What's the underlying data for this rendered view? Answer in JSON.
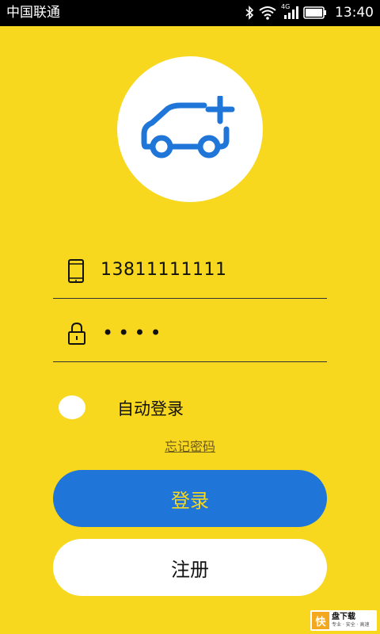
{
  "status_bar": {
    "carrier": "中国联通",
    "network": "4G",
    "time": "13:40"
  },
  "logo": {
    "icon": "car-plus-icon",
    "accent": "#1F76D8"
  },
  "login_form": {
    "phone_value": "13811111111",
    "password_value": "••••",
    "auto_login_label": "自动登录",
    "forgot_password_label": "忘记密码",
    "login_button_label": "登录",
    "register_button_label": "注册"
  },
  "watermark": {
    "mark": "快",
    "title": "盘下载",
    "subtitle": "专业 · 安全 · 高速"
  },
  "colors": {
    "background": "#F8D81E",
    "primary": "#1F76D8",
    "surface": "#FFFFFF"
  }
}
